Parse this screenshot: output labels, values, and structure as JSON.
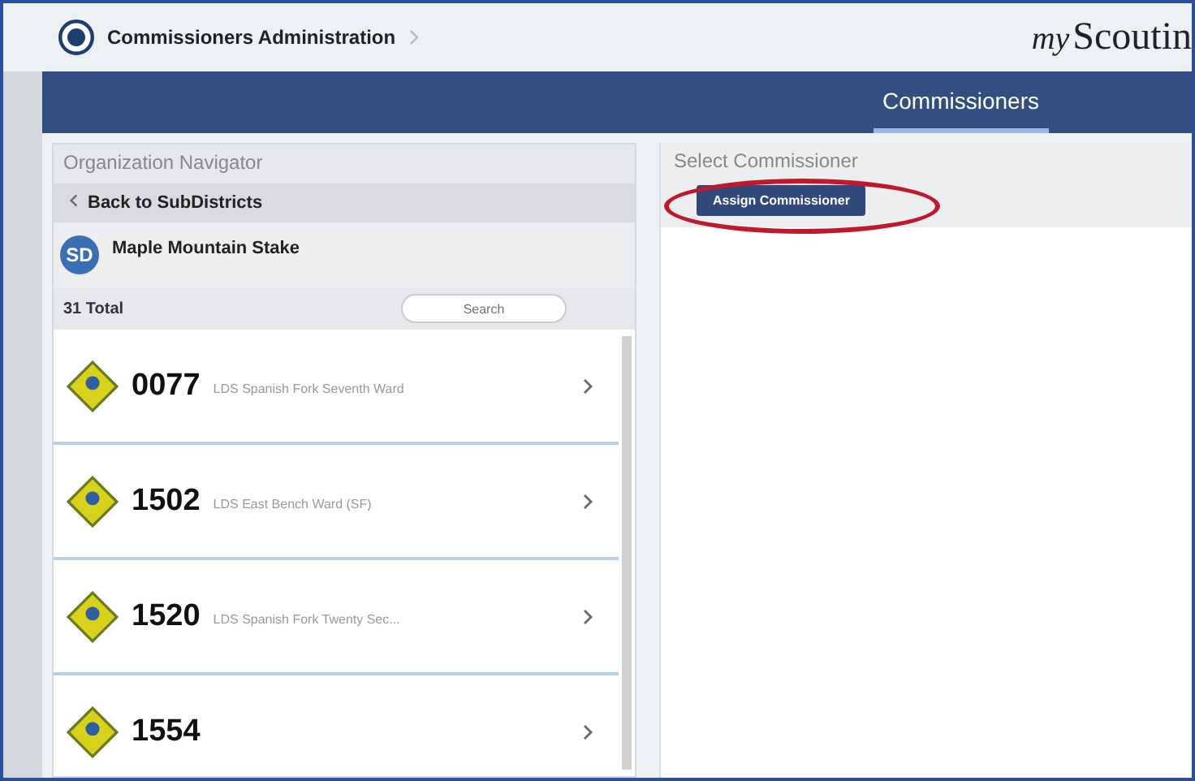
{
  "header": {
    "title": "Commissioners Administration",
    "brand_prefix": "my",
    "brand": "Scoutin"
  },
  "nav": {
    "tabs": [
      {
        "label": "Commissioners",
        "selected": true
      }
    ]
  },
  "navigator": {
    "title": "Organization Navigator",
    "back": "Back to SubDistricts",
    "avatar": "SD",
    "unit_name": "Maple Mountain Stake",
    "total": "31 Total",
    "search": {
      "placeholder": "Search"
    },
    "items": [
      {
        "number": "0077",
        "name": "LDS Spanish Fork Seventh Ward"
      },
      {
        "number": "1502",
        "name": "LDS East Bench Ward (SF)"
      },
      {
        "number": "1520",
        "name": "LDS Spanish Fork Twenty Sec..."
      },
      {
        "number": "1554"
      }
    ]
  },
  "main": {
    "title": "Select Commissioner",
    "button": "Assign Commissioner",
    "highlighted": true
  }
}
